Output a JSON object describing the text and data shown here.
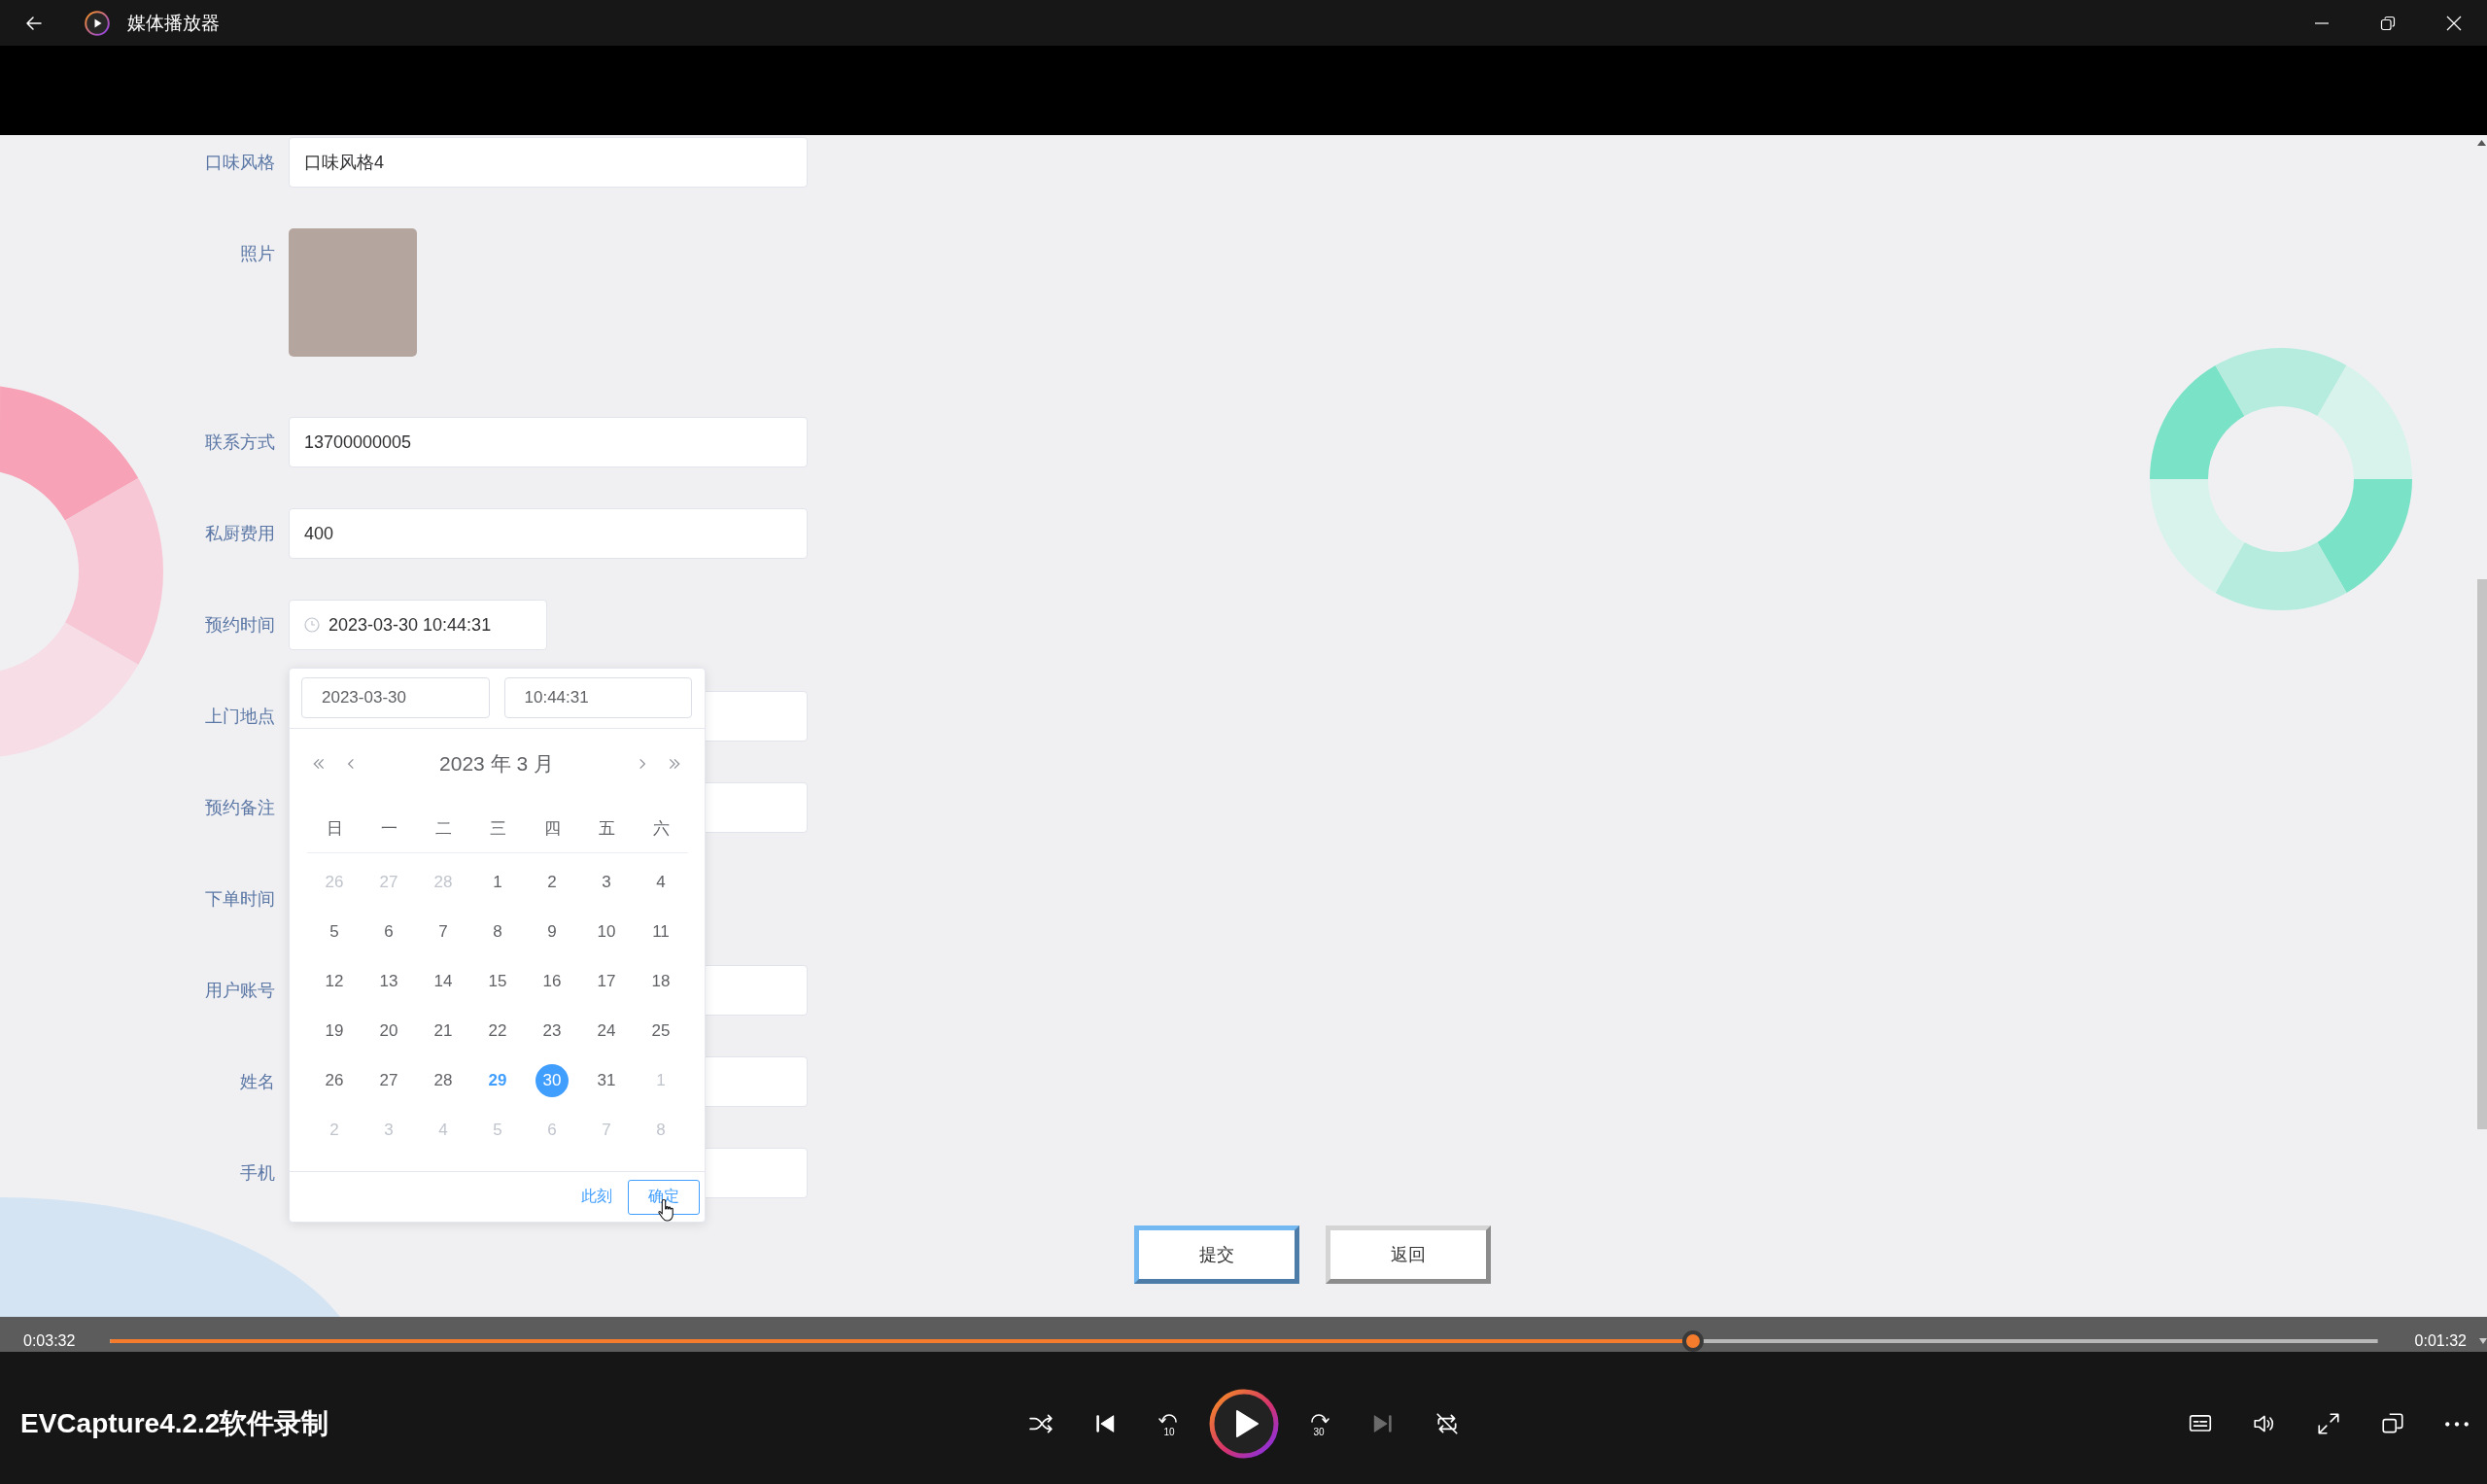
{
  "window": {
    "title": "媒体播放器"
  },
  "form": {
    "fields": [
      {
        "kind": "text",
        "label": "口味风格",
        "value": "口味风格4"
      },
      {
        "kind": "photo",
        "label": "照片"
      },
      {
        "kind": "text",
        "label": "联系方式",
        "value": "13700000005"
      },
      {
        "kind": "text",
        "label": "私厨费用",
        "value": "400"
      },
      {
        "kind": "datetime",
        "label": "预约时间",
        "value": "2023-03-30 10:44:31"
      },
      {
        "kind": "text",
        "label": "上门地点"
      },
      {
        "kind": "text",
        "label": "预约备注"
      },
      {
        "kind": "label_only",
        "label": "下单时间"
      },
      {
        "kind": "text",
        "label": "用户账号"
      },
      {
        "kind": "text",
        "label": "姓名"
      },
      {
        "kind": "text",
        "label": "手机"
      }
    ]
  },
  "date_picker": {
    "date_value": "2023-03-30",
    "time_value": "10:44:31",
    "month_title": "2023 年 3 月",
    "weekdays": [
      "日",
      "一",
      "二",
      "三",
      "四",
      "五",
      "六"
    ],
    "days": [
      {
        "label": "26",
        "other_month": true,
        "today": false,
        "selected": false
      },
      {
        "label": "27",
        "other_month": true,
        "today": false,
        "selected": false
      },
      {
        "label": "28",
        "other_month": true,
        "today": false,
        "selected": false
      },
      {
        "label": "1",
        "other_month": false,
        "today": false,
        "selected": false
      },
      {
        "label": "2",
        "other_month": false,
        "today": false,
        "selected": false
      },
      {
        "label": "3",
        "other_month": false,
        "today": false,
        "selected": false
      },
      {
        "label": "4",
        "other_month": false,
        "today": false,
        "selected": false
      },
      {
        "label": "5",
        "other_month": false,
        "today": false,
        "selected": false
      },
      {
        "label": "6",
        "other_month": false,
        "today": false,
        "selected": false
      },
      {
        "label": "7",
        "other_month": false,
        "today": false,
        "selected": false
      },
      {
        "label": "8",
        "other_month": false,
        "today": false,
        "selected": false
      },
      {
        "label": "9",
        "other_month": false,
        "today": false,
        "selected": false
      },
      {
        "label": "10",
        "other_month": false,
        "today": false,
        "selected": false
      },
      {
        "label": "11",
        "other_month": false,
        "today": false,
        "selected": false
      },
      {
        "label": "12",
        "other_month": false,
        "today": false,
        "selected": false
      },
      {
        "label": "13",
        "other_month": false,
        "today": false,
        "selected": false
      },
      {
        "label": "14",
        "other_month": false,
        "today": false,
        "selected": false
      },
      {
        "label": "15",
        "other_month": false,
        "today": false,
        "selected": false
      },
      {
        "label": "16",
        "other_month": false,
        "today": false,
        "selected": false
      },
      {
        "label": "17",
        "other_month": false,
        "today": false,
        "selected": false
      },
      {
        "label": "18",
        "other_month": false,
        "today": false,
        "selected": false
      },
      {
        "label": "19",
        "other_month": false,
        "today": false,
        "selected": false
      },
      {
        "label": "20",
        "other_month": false,
        "today": false,
        "selected": false
      },
      {
        "label": "21",
        "other_month": false,
        "today": false,
        "selected": false
      },
      {
        "label": "22",
        "other_month": false,
        "today": false,
        "selected": false
      },
      {
        "label": "23",
        "other_month": false,
        "today": false,
        "selected": false
      },
      {
        "label": "24",
        "other_month": false,
        "today": false,
        "selected": false
      },
      {
        "label": "25",
        "other_month": false,
        "today": false,
        "selected": false
      },
      {
        "label": "26",
        "other_month": false,
        "today": false,
        "selected": false
      },
      {
        "label": "27",
        "other_month": false,
        "today": false,
        "selected": false
      },
      {
        "label": "28",
        "other_month": false,
        "today": false,
        "selected": false
      },
      {
        "label": "29",
        "other_month": false,
        "today": true,
        "selected": false
      },
      {
        "label": "30",
        "other_month": false,
        "today": false,
        "selected": true
      },
      {
        "label": "31",
        "other_month": false,
        "today": false,
        "selected": false
      },
      {
        "label": "1",
        "other_month": true,
        "today": false,
        "selected": false
      },
      {
        "label": "2",
        "other_month": true,
        "today": false,
        "selected": false
      },
      {
        "label": "3",
        "other_month": true,
        "today": false,
        "selected": false
      },
      {
        "label": "4",
        "other_month": true,
        "today": false,
        "selected": false
      },
      {
        "label": "5",
        "other_month": true,
        "today": false,
        "selected": false
      },
      {
        "label": "6",
        "other_month": true,
        "today": false,
        "selected": false
      },
      {
        "label": "7",
        "other_month": true,
        "today": false,
        "selected": false
      },
      {
        "label": "8",
        "other_month": true,
        "today": false,
        "selected": false
      }
    ],
    "now_link": "此刻",
    "confirm_button": "确定"
  },
  "actions": [
    {
      "kind": "submit",
      "label": "提交"
    },
    {
      "kind": "back",
      "label": "返回"
    }
  ],
  "player": {
    "elapsed": "0:03:32",
    "remaining": "0:01:32",
    "progress": {
      "level": 0.698
    },
    "media_title": "EVCapture4.2.2软件录制",
    "controls": [
      {
        "kind": "shuffle",
        "disabled": false
      },
      {
        "kind": "previous",
        "disabled": false
      },
      {
        "kind": "skip_back",
        "label": "10",
        "disabled": false
      },
      {
        "kind": "play",
        "disabled": false
      },
      {
        "kind": "skip_forward",
        "label": "30",
        "disabled": false
      },
      {
        "kind": "next",
        "disabled": true
      },
      {
        "kind": "repeat",
        "disabled": false
      }
    ],
    "side_controls": [
      {
        "kind": "subtitles"
      },
      {
        "kind": "volume"
      },
      {
        "kind": "fullscreen"
      },
      {
        "kind": "mini_player"
      },
      {
        "kind": "more"
      }
    ]
  }
}
